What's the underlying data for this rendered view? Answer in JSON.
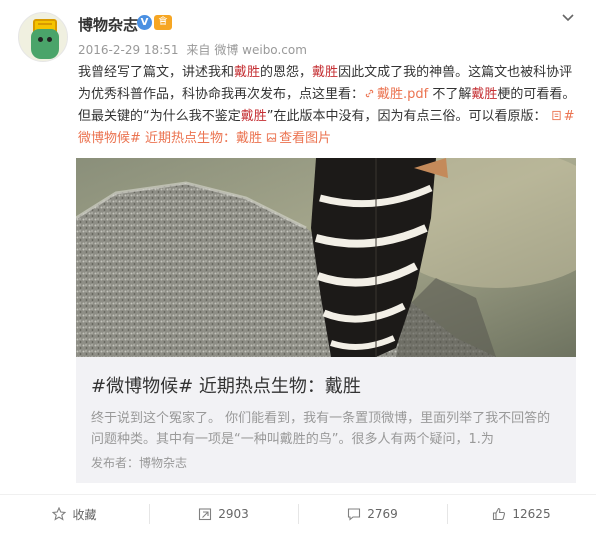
{
  "user": {
    "name": "博物杂志",
    "verified_mark": "V",
    "member_badge": "會"
  },
  "meta": {
    "date": "2016-2-29 18:51",
    "source_prefix": "来自",
    "source": "微博 weibo.com"
  },
  "post": {
    "p1": "我曾经写了篇文，讲述我和",
    "r1": "戴胜",
    "p2": "的恩怨，",
    "r2": "戴胜",
    "p3": "因此文成了我的神兽。这篇文也被科协评为优秀科普作品，科协命我再次发布，点这里看：",
    "pdf_link": "戴胜.pdf",
    "p4": " 不了解",
    "r3": "戴胜",
    "p5": "梗的可看看。但最关键的“为什么我不鉴定",
    "r4": "戴胜",
    "p6": "”在此版本中没有，因为有点三俗。可以看原版：",
    "topic_link": "#微博物候# 近期热点生物：戴胜",
    "image_link": "查看图片"
  },
  "card": {
    "title": "#微博物候# 近期热点生物：戴胜",
    "description": "终于说到这个冤家了。 你们能看到，我有一条置顶微博，里面列举了我不回答的问题种类。其中有一项是“一种叫戴胜的鸟”。很多人有两个疑问，1.为",
    "publisher": "发布者：博物杂志"
  },
  "actions": {
    "favorite": "收藏",
    "repost": "2903",
    "comment": "2769",
    "like": "12625"
  },
  "colors": {
    "highlight": "#c53034",
    "link": "#eb7350",
    "card_bg": "#f2f2f5"
  }
}
